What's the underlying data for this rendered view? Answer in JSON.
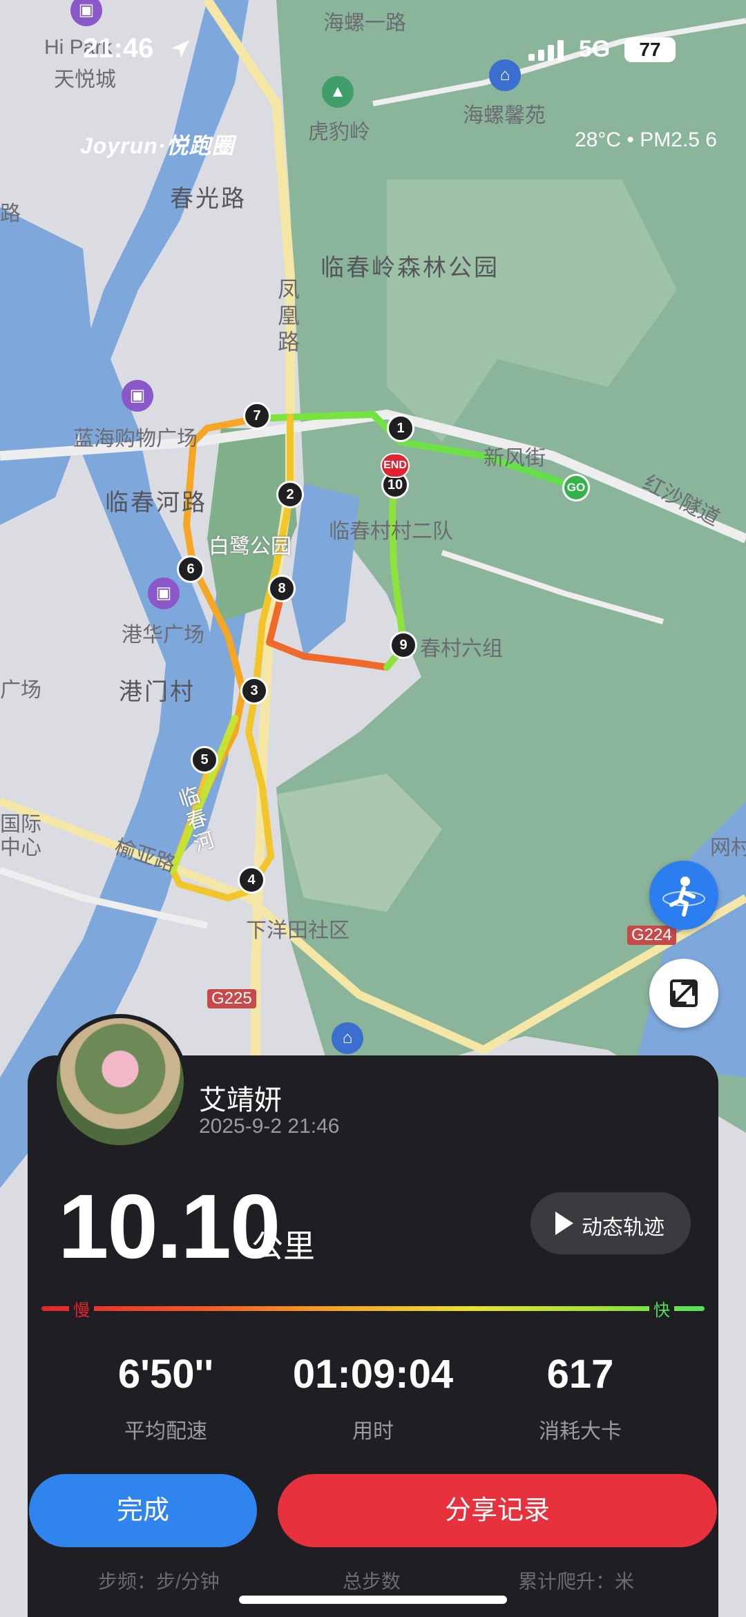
{
  "status_bar": {
    "time": "21:46",
    "network": "5G",
    "battery": "77"
  },
  "brand": "Joyrun·悦跑圈",
  "weather": "28°C • PM2.5 6",
  "map_labels": {
    "hi_park": "Hi Park",
    "tianyue": "天悦城",
    "haiyi_road": "海螺一路",
    "haiyi_xinyuan": "海螺馨苑",
    "hubaoling": "虎豹岭",
    "chunguang": "春光路",
    "forest_park": "临春岭森林公园",
    "fenghuang": "凤凰路",
    "lanhai": "蓝海购物广场",
    "linchunhe_road": "临春河路",
    "bailu_park": "白鹭公园",
    "village2": "临春村村二队",
    "xinfeng_street": "新风街",
    "hongsha": "红沙隧道",
    "ganghua": "港华广场",
    "gangmen": "港门村",
    "village6": "春村六组",
    "linchun_river": "临春河",
    "yuya": "榆亚路",
    "xiayangtian": "下洋田社区",
    "g224": "G224",
    "g225": "G225",
    "wangcun": "网村",
    "guoji": "国际",
    "zhongxin": "中心",
    "lu": "路",
    "chang": "广场"
  },
  "route": {
    "markers": [
      "1",
      "2",
      "3",
      "4",
      "5",
      "6",
      "7",
      "8",
      "9",
      "10"
    ],
    "start_label": "GO",
    "end_label": "END"
  },
  "profile": {
    "name": "艾靖妍",
    "datetime": "2025-9-2 21:46"
  },
  "summary": {
    "distance": "10.10",
    "unit": "公里",
    "dynamic_track": "动态轨迹"
  },
  "speed_legend": {
    "slow": "慢",
    "fast": "快"
  },
  "stats": [
    {
      "value": "6'50''",
      "label": "平均配速"
    },
    {
      "value": "01:09:04",
      "label": "用时"
    },
    {
      "value": "617",
      "label": "消耗大卡"
    }
  ],
  "actions": {
    "done": "完成",
    "share": "分享记录"
  },
  "hidden_stats": [
    "步频：步/分钟",
    "总步数",
    "累计爬升：米"
  ],
  "colors": {
    "done_button": "#2f84ee",
    "share_button": "#e7323e",
    "card": "#1f1f23",
    "go": "#36b24a",
    "end": "#e0242f"
  }
}
